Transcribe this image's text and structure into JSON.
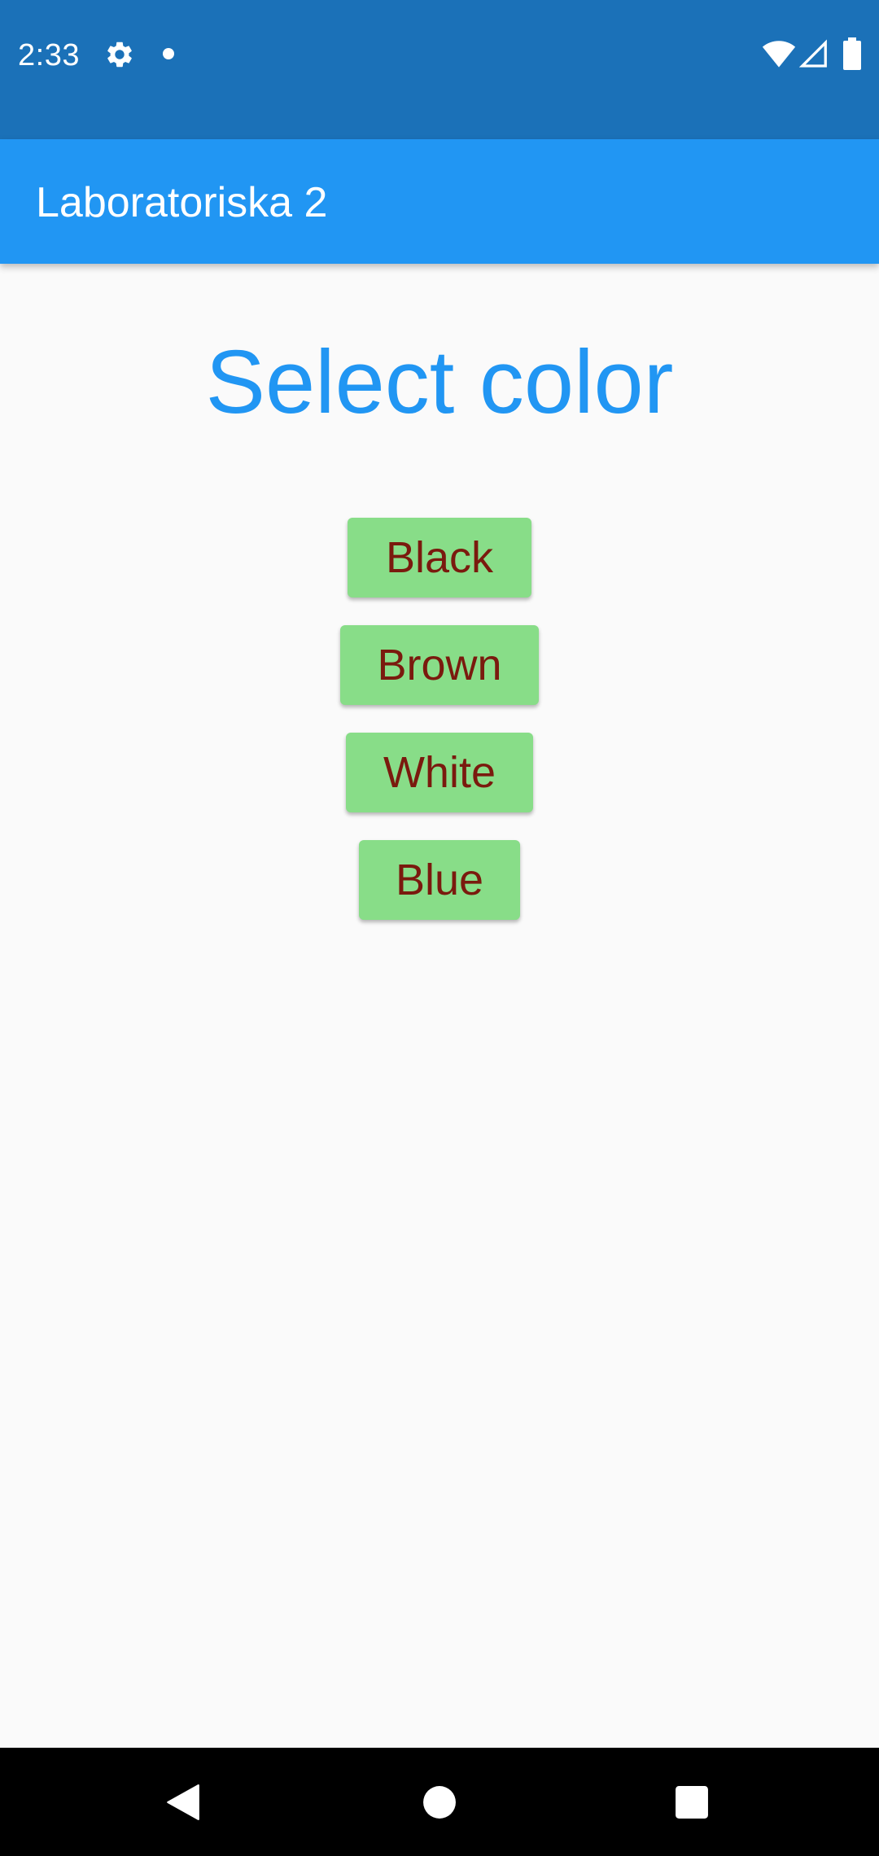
{
  "status_bar": {
    "time": "2:33",
    "icons": [
      "gear-icon",
      "notification-dot-icon",
      "wifi-icon",
      "signal-icon",
      "battery-icon"
    ],
    "background": "#1b71b8"
  },
  "app_bar": {
    "title": "Laboratoriska 2",
    "background": "#2196f3"
  },
  "main": {
    "heading": "Select color",
    "heading_color": "#2196f3",
    "buttons": [
      {
        "label": "Black"
      },
      {
        "label": "Brown"
      },
      {
        "label": "White"
      },
      {
        "label": "Blue"
      }
    ],
    "button_background": "#88dd88",
    "button_text_color": "#7a1a0e"
  },
  "nav_bar": {
    "icons": [
      "back-icon",
      "home-icon",
      "recents-icon"
    ]
  }
}
